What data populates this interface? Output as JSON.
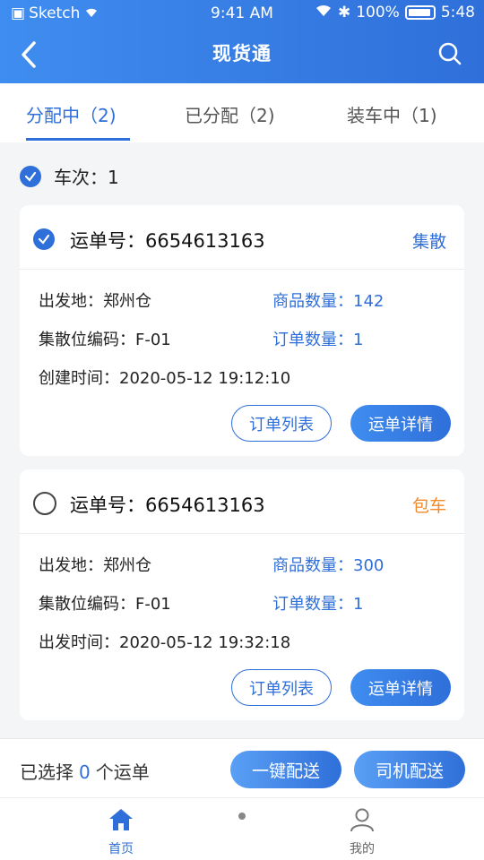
{
  "status": {
    "carrier": "Sketch",
    "time": "9:41 AM",
    "battery": "100%",
    "right_time": "5:48"
  },
  "nav": {
    "title": "现货通"
  },
  "tabs": [
    {
      "label": "分配中（2)"
    },
    {
      "label": "已分配（2)"
    },
    {
      "label": "装车中（1)"
    }
  ],
  "trip": {
    "label": "车次：1"
  },
  "cards": [
    {
      "waybill": "运单号：6654613163",
      "tag": "集散",
      "tag_color": "#2f6fd9",
      "origin": "出发地：郑州仓",
      "qty_label": "商品数量：",
      "qty": "142",
      "code": "集散位编码：F-01",
      "order_label": "订单数量：",
      "order_count": "1",
      "time": "创建时间：2020-05-12  19:12:10",
      "btn_list": "订单列表",
      "btn_detail": "运单详情",
      "selected": true
    },
    {
      "waybill": "运单号：6654613163",
      "tag": "包车",
      "tag_color": "#f08a2a",
      "origin": "出发地：郑州仓",
      "qty_label": "商品数量：",
      "qty": "300",
      "code": "集散位编码：F-01",
      "order_label": "订单数量：",
      "order_count": "1",
      "time": "出发时间：2020-05-12  19:32:18",
      "btn_list": "订单列表",
      "btn_detail": "运单详情",
      "selected": false
    }
  ],
  "bottom": {
    "prefix": "已选择",
    "count": "0",
    "suffix": "个运单",
    "btn_one_click": "一键配送",
    "btn_driver": "司机配送"
  },
  "tabbar": {
    "home": "首页",
    "mine": "我的"
  },
  "colors": {
    "primary": "#2f6fd9",
    "orange": "#f08a2a"
  }
}
